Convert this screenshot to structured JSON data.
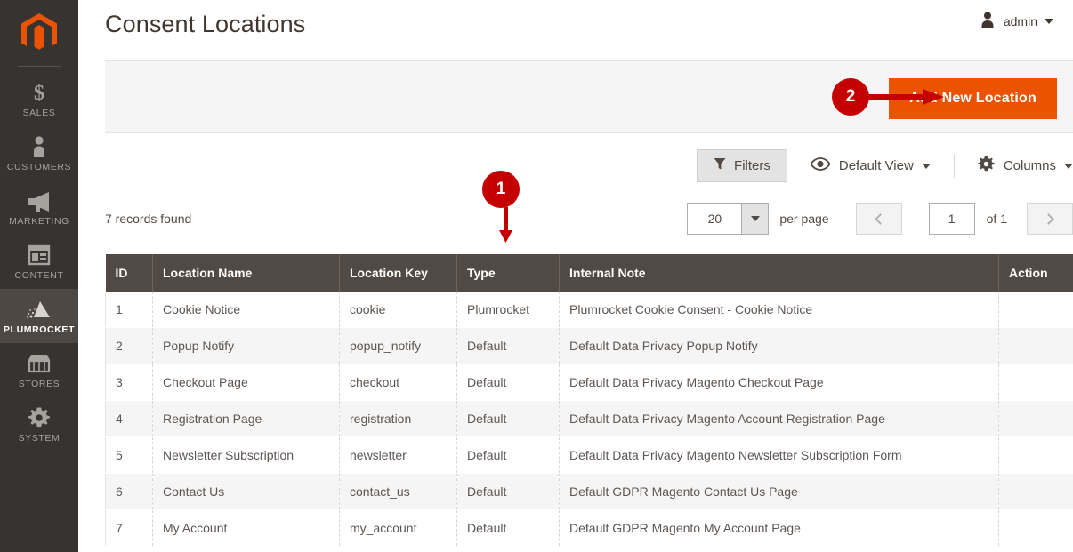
{
  "sidebar": {
    "logo": "magento-logo",
    "items": [
      {
        "label": "SALES",
        "icon": "dollar-icon",
        "active": false
      },
      {
        "label": "CUSTOMERS",
        "icon": "person-icon",
        "active": false
      },
      {
        "label": "MARKETING",
        "icon": "megaphone-icon",
        "active": false
      },
      {
        "label": "CONTENT",
        "icon": "layout-icon",
        "active": false
      },
      {
        "label": "PLUMROCKET",
        "icon": "pyramid-icon",
        "active": true
      },
      {
        "label": "STORES",
        "icon": "storefront-icon",
        "active": false
      },
      {
        "label": "SYSTEM",
        "icon": "gear-icon",
        "active": false
      }
    ]
  },
  "header": {
    "title": "Consent Locations",
    "admin_user": "admin"
  },
  "page_actions": {
    "add_new_label": "Add New Location"
  },
  "toolbar": {
    "filters_label": "Filters",
    "view_label": "Default View",
    "columns_label": "Columns"
  },
  "grid_meta": {
    "records_found": "7 records found",
    "per_page_value": "20",
    "per_page_label": "per page",
    "page_value": "1",
    "page_total": "of 1"
  },
  "table": {
    "columns": [
      "ID",
      "Location Name",
      "Location Key",
      "Type",
      "Internal Note",
      "Action"
    ],
    "rows": [
      {
        "id": "1",
        "name": "Cookie Notice",
        "key": "cookie",
        "type": "Plumrocket",
        "note": "Plumrocket Cookie Consent - Cookie Notice",
        "action": ""
      },
      {
        "id": "2",
        "name": "Popup Notify",
        "key": "popup_notify",
        "type": "Default",
        "note": "Default Data Privacy Popup Notify",
        "action": ""
      },
      {
        "id": "3",
        "name": "Checkout Page",
        "key": "checkout",
        "type": "Default",
        "note": "Default Data Privacy Magento Checkout Page",
        "action": ""
      },
      {
        "id": "4",
        "name": "Registration Page",
        "key": "registration",
        "type": "Default",
        "note": "Default Data Privacy Magento Account Registration Page",
        "action": ""
      },
      {
        "id": "5",
        "name": "Newsletter Subscription",
        "key": "newsletter",
        "type": "Default",
        "note": "Default Data Privacy Magento Newsletter Subscription Form",
        "action": ""
      },
      {
        "id": "6",
        "name": "Contact Us",
        "key": "contact_us",
        "type": "Default",
        "note": "Default GDPR Magento Contact Us Page",
        "action": ""
      },
      {
        "id": "7",
        "name": "My Account",
        "key": "my_account",
        "type": "Default",
        "note": "Default GDPR Magento My Account Page",
        "action": ""
      }
    ]
  },
  "annotations": [
    {
      "number": "1",
      "direction": "down"
    },
    {
      "number": "2",
      "direction": "right"
    }
  ],
  "colors": {
    "brand_orange": "#eb5202",
    "sidebar_bg": "#373330",
    "table_header_bg": "#514943",
    "marker_red": "#c40000"
  }
}
